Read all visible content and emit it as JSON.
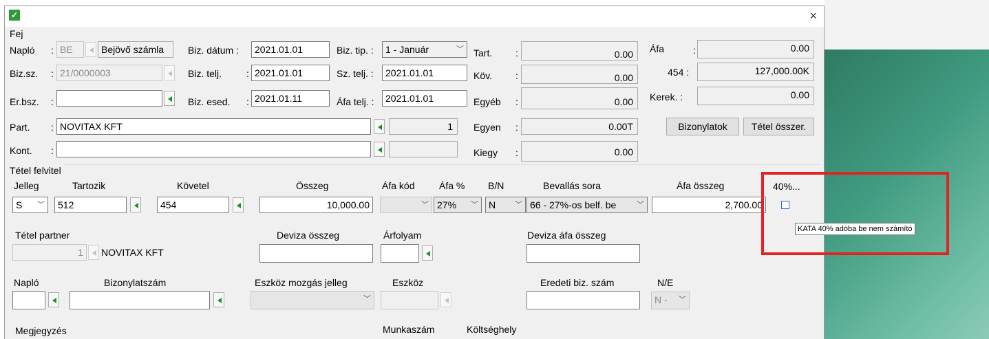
{
  "window": {
    "close_label": "×",
    "icon": "check-icon"
  },
  "fej": {
    "title": "Fej",
    "naplo_label": "Napló",
    "colon": ":",
    "naplo_value": "BE",
    "naplo_name": "Bejövő számla",
    "bizsz_label": "Biz.sz.",
    "bizsz_value": "21/0000003",
    "erbsz_label": "Er.bsz.",
    "part_label": "Part.",
    "part_value": "NOVITAX KFT",
    "part_count": "1",
    "kont_label": "Kont.",
    "biz_datum_label": "Biz. dátum :",
    "biz_datum_value": "2021.01.01",
    "biz_telj_label": "Biz. telj.",
    "biz_telj_value": "2021.01.01",
    "biz_esed_label": "Biz. esed.",
    "biz_esed_value": "2021.01.11",
    "biz_tip_label": "Biz. tip. :",
    "biz_tip_value": "1 - Január",
    "sz_telj_label": "Sz. telj. :",
    "sz_telj_value": "2021.01.01",
    "afa_telj_label": "Áfa telj. :",
    "afa_telj_value": "2021.01.01",
    "tart_label": "Tart.",
    "tart_value": "0.00",
    "kov_label": "Köv.",
    "kov_value": "0.00",
    "egyeb_label": "Egyéb",
    "egyeb_value": "0.00",
    "egyen_label": "Egyen",
    "egyen_value": "0.00T",
    "kiegy_label": "Kiegy",
    "kiegy_value": "0.00",
    "afa_label": "Áfa",
    "afa_value": "0.00",
    "num454_label": "454 :",
    "num454_value": "127,000.00K",
    "kerek_label": "Kerek. :",
    "kerek_value": "0.00",
    "bizonylatok_button": "Bizonylatok",
    "tetel_osszer_button": "Tétel összer."
  },
  "tetel": {
    "title": "Tétel felvitel",
    "jelleg_label": "Jelleg",
    "jelleg_value": "S",
    "tartozik_label": "Tartozik",
    "tartozik_value": "512",
    "kovetel_label": "Követel",
    "kovetel_value": "454",
    "osszeg_label": "Összeg",
    "osszeg_value": "10,000.00",
    "afa_kod_label": "Áfa kód",
    "afa_kod_value": "",
    "afa_pct_label": "Áfa %",
    "afa_pct_value": "27%",
    "bn_label": "B/N",
    "bn_value": "N",
    "bevallas_label": "Bevallás sora",
    "bevallas_value": "66 - 27%-os belf. be",
    "afa_osszeg_label": "Áfa összeg",
    "afa_osszeg_value": "2,700.00",
    "kata_label": "40%...",
    "kata_tooltip": "KATA 40% adóba be nem számító",
    "tetel_partner_label": "Tétel partner",
    "tetel_partner_num": "1",
    "tetel_partner_name": "NOVITAX KFT",
    "deviza_osszeg_label": "Deviza összeg",
    "arfolyam_label": "Árfolyam",
    "deviza_afa_label": "Deviza áfa összeg",
    "naplo2_label": "Napló",
    "bizonylatszam_label": "Bizonylatszám",
    "eszkoz_mozgas_label": "Eszköz mozgás jelleg",
    "eszkoz_label": "Eszköz",
    "eredeti_label": "Eredeti biz. szám",
    "ne_label": "N/E",
    "ne_value": "N -",
    "megjegyzes_label": "Megjegyzés",
    "munkaszam_label": "Munkaszám",
    "koltseghely_label": "Költséghely"
  }
}
